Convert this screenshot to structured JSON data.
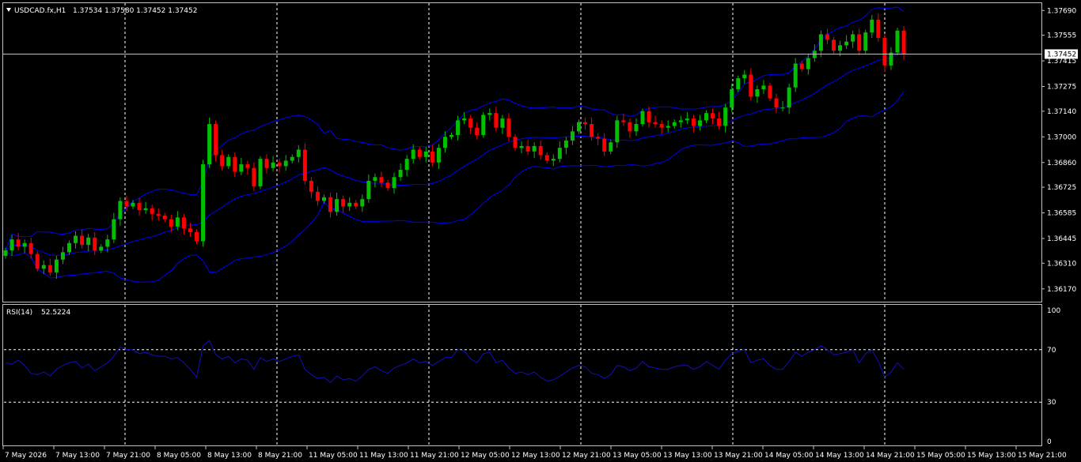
{
  "header": {
    "symbol": "USDCAD.fx,H1",
    "ohlc": "1.37534 1.37580 1.37452 1.37452"
  },
  "colors": {
    "background": "#000000",
    "bull": "#00c000",
    "bear": "#ff0000",
    "bollinger": "#0000ff",
    "rsi_line": "#1010c0",
    "grid": "#ffffff"
  },
  "chart_data": [
    {
      "type": "candlestick",
      "title": "USDCAD.fx,H1",
      "open": 1.37534,
      "high": 1.3758,
      "low": 1.37452,
      "close": 1.37452,
      "bid_line": 1.37452,
      "ylim": [
        1.361,
        1.3773
      ],
      "y_ticks": [
        "1.37690",
        "1.37555",
        "1.37415",
        "1.37275",
        "1.37140",
        "1.37000",
        "1.36860",
        "1.36725",
        "1.36585",
        "1.36445",
        "1.36310",
        "1.36170"
      ],
      "y_tick_values": [
        1.3769,
        1.37555,
        1.37415,
        1.37275,
        1.3714,
        1.37,
        1.3686,
        1.36725,
        1.36585,
        1.36445,
        1.3631,
        1.3617
      ],
      "x_ticks": [
        "7 May 2026",
        "7 May 13:00",
        "7 May 21:00",
        "8 May 05:00",
        "8 May 13:00",
        "8 May 21:00",
        "11 May 05:00",
        "11 May 13:00",
        "11 May 21:00",
        "12 May 05:00",
        "12 May 13:00",
        "12 May 21:00",
        "13 May 05:00",
        "13 May 13:00",
        "13 May 21:00",
        "14 May 05:00",
        "14 May 13:00",
        "14 May 21:00",
        "15 May 05:00",
        "15 May 13:00",
        "15 May 21:00"
      ],
      "grid": true,
      "indicators": [
        "Bollinger Bands"
      ],
      "candles_close": [
        1.3638,
        1.3644,
        1.364,
        1.3642,
        1.3636,
        1.3628,
        1.363,
        1.3626,
        1.3633,
        1.3637,
        1.3642,
        1.3646,
        1.3641,
        1.3645,
        1.3638,
        1.364,
        1.3644,
        1.3655,
        1.3665,
        1.3662,
        1.3664,
        1.366,
        1.3661,
        1.3658,
        1.3657,
        1.3655,
        1.3651,
        1.3656,
        1.365,
        1.3648,
        1.3643,
        1.3685,
        1.3707,
        1.369,
        1.3684,
        1.3689,
        1.3681,
        1.3685,
        1.3683,
        1.3673,
        1.3688,
        1.3683,
        1.3686,
        1.3684,
        1.3687,
        1.3689,
        1.3693,
        1.3676,
        1.367,
        1.3665,
        1.3667,
        1.3659,
        1.3666,
        1.3662,
        1.3664,
        1.3662,
        1.3666,
        1.3676,
        1.3678,
        1.3675,
        1.3672,
        1.3678,
        1.3682,
        1.3688,
        1.3693,
        1.3689,
        1.3692,
        1.3686,
        1.3694,
        1.37,
        1.3701,
        1.3709,
        1.371,
        1.3705,
        1.3701,
        1.3712,
        1.3713,
        1.3705,
        1.371,
        1.37,
        1.3694,
        1.3695,
        1.3692,
        1.3695,
        1.369,
        1.3687,
        1.3688,
        1.3694,
        1.3698,
        1.3703,
        1.3708,
        1.3707,
        1.37,
        1.3699,
        1.3692,
        1.3697,
        1.3709,
        1.3708,
        1.3703,
        1.3707,
        1.3714,
        1.3708,
        1.3707,
        1.3705,
        1.3706,
        1.3708,
        1.3709,
        1.371,
        1.3706,
        1.3709,
        1.3713,
        1.371,
        1.3706,
        1.3716,
        1.3726,
        1.3732,
        1.3734,
        1.3722,
        1.3726,
        1.3728,
        1.3721,
        1.3716,
        1.3716,
        1.3727,
        1.374,
        1.3737,
        1.3743,
        1.3747,
        1.3756,
        1.3753,
        1.3747,
        1.375,
        1.3752,
        1.3756,
        1.3747,
        1.3757,
        1.3764,
        1.3754,
        1.3739,
        1.3746,
        1.3758,
        1.3745
      ]
    },
    {
      "type": "line",
      "title": "RSI(14)",
      "value_label": "52.5224",
      "ylim": [
        0,
        100
      ],
      "y_ticks": [
        "100",
        "70",
        "30",
        "0"
      ],
      "y_tick_values": [
        100,
        70,
        30,
        0
      ],
      "levels": [
        70,
        30
      ],
      "values": [
        60,
        59,
        62,
        58,
        52,
        51,
        53,
        50,
        55,
        58,
        60,
        61,
        56,
        59,
        54,
        57,
        60,
        65,
        72,
        70,
        70,
        67,
        68,
        66,
        65,
        65,
        63,
        64,
        60,
        55,
        49,
        73,
        77,
        66,
        63,
        65,
        60,
        63,
        62,
        55,
        64,
        61,
        63,
        61,
        63,
        65,
        66,
        55,
        51,
        48,
        49,
        45,
        50,
        47,
        48,
        46,
        50,
        55,
        57,
        54,
        52,
        56,
        58,
        60,
        63,
        60,
        61,
        58,
        61,
        64,
        64,
        70,
        69,
        63,
        60,
        67,
        68,
        60,
        62,
        56,
        52,
        53,
        51,
        53,
        49,
        46,
        47,
        50,
        53,
        56,
        58,
        57,
        52,
        51,
        48,
        51,
        58,
        57,
        54,
        56,
        61,
        57,
        56,
        55,
        55,
        57,
        58,
        58,
        55,
        57,
        61,
        58,
        55,
        62,
        67,
        69,
        70,
        60,
        62,
        63,
        58,
        55,
        55,
        61,
        68,
        65,
        68,
        70,
        73,
        70,
        66,
        67,
        68,
        70,
        60,
        67,
        70,
        61,
        49,
        53,
        60,
        55
      ]
    }
  ]
}
